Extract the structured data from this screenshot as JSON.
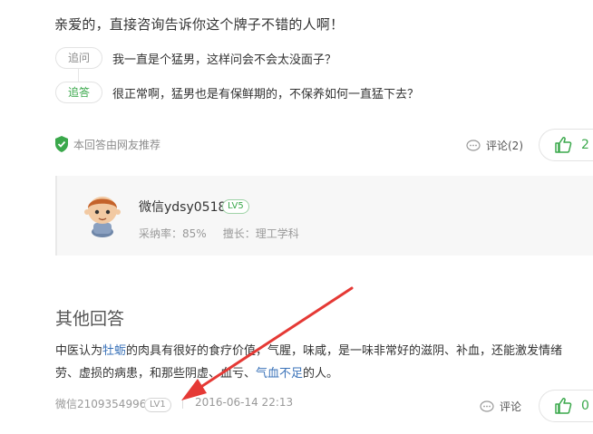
{
  "answer": {
    "text": "亲爱的，直接咨询告诉你这个牌子不错的人啊！",
    "followups": [
      {
        "tag": "追问",
        "text": "我一直是个猛男，这样问会不会太没面子？"
      },
      {
        "tag": "追答",
        "text": "很正常啊，猛男也是有保鲜期的，不保养如何一直猛下去？"
      }
    ],
    "recommend_label": "本回答由网友推荐",
    "comment_label": "评论(2)",
    "like_count": "2"
  },
  "answerer": {
    "name": "微信ydsy0518",
    "level": "LV5",
    "adoption_label": "采纳率：85%",
    "expertise_label": "擅长：理工学科"
  },
  "other_answers": {
    "title": "其他回答",
    "body": {
      "seg1": "中医认为",
      "link1": "牡蛎",
      "seg2": "的肉具有很好的食疗价值，气腥，味咸，是一味非常好的滋阴、补血，还能激发情绪",
      "seg3": "劳、虚损的病患，和那些阴虚、血亏、",
      "link2": "气血不足",
      "seg4": "的人。"
    },
    "meta": {
      "user": "微信2109354996",
      "level": "LV1",
      "date": "2016-06-14 22:13"
    },
    "comment_label": "评论",
    "like_count": "0"
  },
  "colors": {
    "accent_green": "#3aa84b",
    "link_blue": "#3b73b9",
    "annotation_red": "#e53935"
  },
  "icons": [
    "shield-check-icon",
    "comment-bubble-icon",
    "thumbs-up-icon",
    "avatar-cartoon"
  ]
}
